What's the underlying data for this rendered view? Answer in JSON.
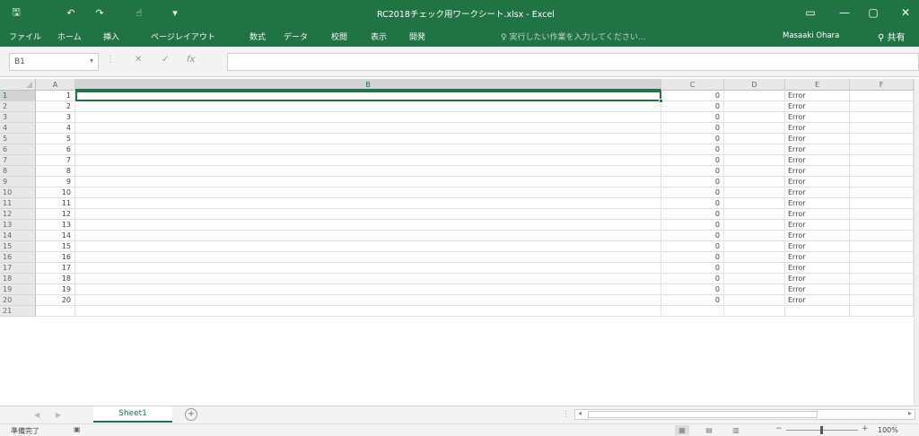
{
  "window": {
    "title": "RC2018チェック用ワークシート.xlsx - Excel",
    "save_icon": "save-icon",
    "restore_icon": "ribbon-display-icon"
  },
  "quick_access": {
    "save": "🖫",
    "undo": "↶",
    "redo": "↷",
    "customize": "▾"
  },
  "ribbon": {
    "tabs": [
      "ファイル",
      "ホーム",
      "挿入",
      "ページレイアウト",
      "数式",
      "データ",
      "校閲",
      "表示",
      "開発"
    ],
    "tell_me": "♀ 実行したい作業を入力してください...",
    "user": "Masaaki Ohara",
    "share": "共有"
  },
  "formula_bar": {
    "name_box": "B1",
    "cancel": "✕",
    "enter": "✓",
    "fx": "fx",
    "value": ""
  },
  "columns": [
    "A",
    "B",
    "C",
    "D",
    "E",
    "F"
  ],
  "rows": [
    {
      "n": "1",
      "a": "1",
      "c": "0",
      "e": "Error"
    },
    {
      "n": "2",
      "a": "2",
      "c": "0",
      "e": "Error"
    },
    {
      "n": "3",
      "a": "3",
      "c": "0",
      "e": "Error"
    },
    {
      "n": "4",
      "a": "4",
      "c": "0",
      "e": "Error"
    },
    {
      "n": "5",
      "a": "5",
      "c": "0",
      "e": "Error"
    },
    {
      "n": "6",
      "a": "6",
      "c": "0",
      "e": "Error"
    },
    {
      "n": "7",
      "a": "7",
      "c": "0",
      "e": "Error"
    },
    {
      "n": "8",
      "a": "8",
      "c": "0",
      "e": "Error"
    },
    {
      "n": "9",
      "a": "9",
      "c": "0",
      "e": "Error"
    },
    {
      "n": "10",
      "a": "10",
      "c": "0",
      "e": "Error"
    },
    {
      "n": "11",
      "a": "11",
      "c": "0",
      "e": "Error"
    },
    {
      "n": "12",
      "a": "12",
      "c": "0",
      "e": "Error"
    },
    {
      "n": "13",
      "a": "13",
      "c": "0",
      "e": "Error"
    },
    {
      "n": "14",
      "a": "14",
      "c": "0",
      "e": "Error"
    },
    {
      "n": "15",
      "a": "15",
      "c": "0",
      "e": "Error"
    },
    {
      "n": "16",
      "a": "16",
      "c": "0",
      "e": "Error"
    },
    {
      "n": "17",
      "a": "17",
      "c": "0",
      "e": "Error"
    },
    {
      "n": "18",
      "a": "18",
      "c": "0",
      "e": "Error"
    },
    {
      "n": "19",
      "a": "19",
      "c": "0",
      "e": "Error"
    },
    {
      "n": "20",
      "a": "20",
      "c": "0",
      "e": "Error"
    },
    {
      "n": "21",
      "a": "",
      "c": "",
      "e": ""
    }
  ],
  "sheets": {
    "active": "Sheet1",
    "add": "+"
  },
  "status": {
    "ready": "準備完了",
    "zoom": "100%",
    "zoom_minus": "−",
    "zoom_plus": "+"
  },
  "colors": {
    "accent": "#217346"
  }
}
